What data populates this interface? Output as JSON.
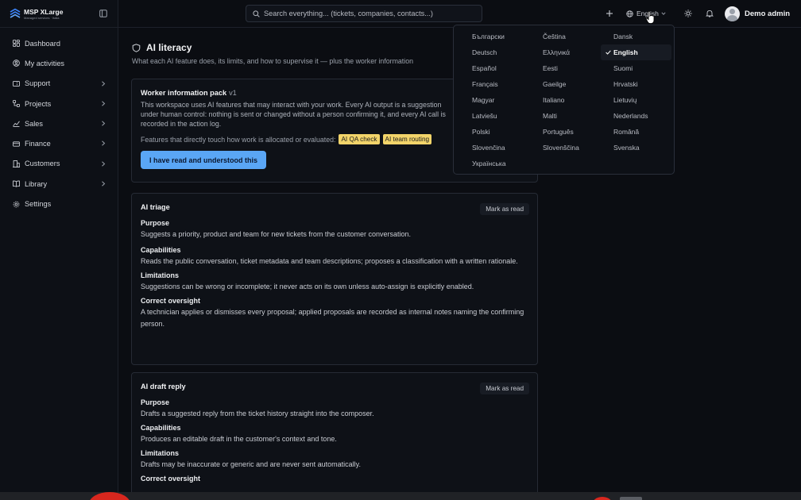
{
  "brand": {
    "name": "MSP XLarge",
    "tagline": "Managed services · Italia"
  },
  "search": {
    "placeholder": "Search everything... (tickets, companies, contacts...)"
  },
  "topbar": {
    "language": "English",
    "user_name": "Demo admin"
  },
  "sidebar": {
    "items": [
      {
        "label": "Dashboard",
        "icon": "dashboard-icon",
        "has_children": false
      },
      {
        "label": "My activities",
        "icon": "user-circle-icon",
        "has_children": false
      },
      {
        "label": "Support",
        "icon": "support-icon",
        "has_children": true
      },
      {
        "label": "Projects",
        "icon": "projects-icon",
        "has_children": true
      },
      {
        "label": "Sales",
        "icon": "chart-line-icon",
        "has_children": true
      },
      {
        "label": "Finance",
        "icon": "finance-icon",
        "has_children": true
      },
      {
        "label": "Customers",
        "icon": "customers-icon",
        "has_children": true
      },
      {
        "label": "Library",
        "icon": "book-icon",
        "has_children": true
      },
      {
        "label": "Settings",
        "icon": "gear-icon",
        "has_children": false
      }
    ]
  },
  "page": {
    "title": "AI literacy",
    "subtitle": "What each AI feature does, its limits, and how to supervise it — plus the worker information"
  },
  "info_pack": {
    "title": "Worker information pack",
    "version": "v1",
    "body": "This workspace uses AI features that may interact with your work. Every AI output is a suggestion under human control: nothing is sent or changed without a person confirming it, and every AI call is recorded in the action log.",
    "features_label": "Features that directly touch how work is allocated or evaluated:",
    "tags": [
      "AI QA check",
      "AI team routing"
    ],
    "ack_button": "I have read and understood this"
  },
  "labels": {
    "purpose": "Purpose",
    "capabilities": "Capabilities",
    "limitations": "Limitations",
    "oversight": "Correct oversight",
    "mark_read": "Mark as read"
  },
  "features": [
    {
      "title": "AI triage",
      "purpose": "Suggests a priority, product and team for new tickets from the customer conversation.",
      "capabilities": "Reads the public conversation, ticket metadata and team descriptions; proposes a classification with a written rationale.",
      "limitations": "Suggestions can be wrong or incomplete; it never acts on its own unless auto-assign is explicitly enabled.",
      "oversight": "A technician applies or dismisses every proposal; applied proposals are recorded as internal notes naming the confirming person."
    },
    {
      "title": "AI draft reply",
      "purpose": "Drafts a suggested reply from the ticket history straight into the composer.",
      "capabilities": "Produces an editable draft in the customer's context and tone.",
      "limitations": "Drafts may be inaccurate or generic and are never sent automatically.",
      "oversight": ""
    }
  ],
  "languages": [
    "Български",
    "Čeština",
    "Dansk",
    "Deutsch",
    "Ελληνικά",
    "English",
    "Español",
    "Eesti",
    "Suomi",
    "Français",
    "Gaeilge",
    "Hrvatski",
    "Magyar",
    "Italiano",
    "Lietuvių",
    "Latviešu",
    "Malti",
    "Nederlands",
    "Polski",
    "Português",
    "Română",
    "Slovenčina",
    "Slovenščina",
    "Svenska",
    "Українська"
  ],
  "selected_language": "English",
  "colors": {
    "accent": "#5aa6f5",
    "tag": "#f2d46a",
    "background": "#0b0d12"
  }
}
